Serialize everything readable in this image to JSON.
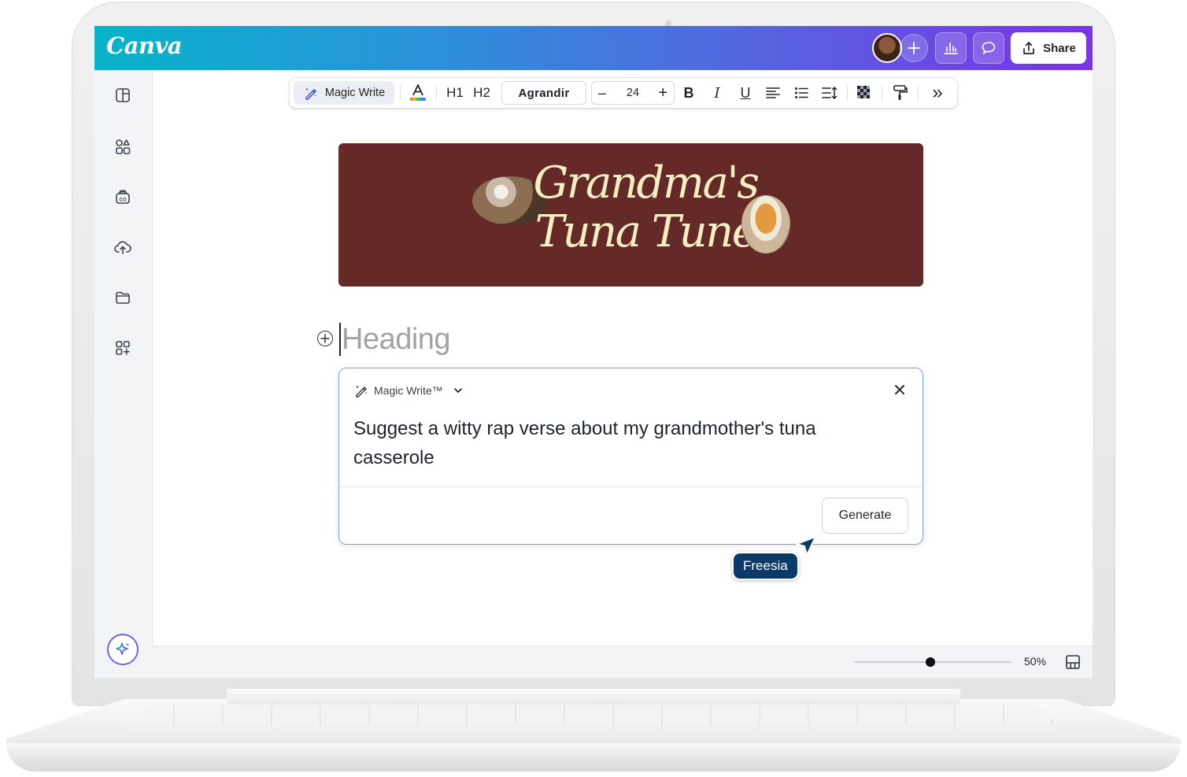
{
  "app": {
    "logo_text": "Canva",
    "brand_gradient": [
      "#07b4c8",
      "#7a33e6"
    ]
  },
  "header": {
    "share_label": "Share",
    "icons": [
      "avatar",
      "add-collaborator-icon",
      "analytics-icon",
      "comment-icon",
      "share-icon"
    ]
  },
  "sidebar": {
    "items": [
      "design-panel-icon",
      "elements-icon",
      "brand-icon",
      "uploads-icon",
      "projects-icon",
      "apps-icon"
    ],
    "magic_icon": "sparkle-icon"
  },
  "toolbar": {
    "magic_write_label": "Magic Write",
    "h1_label": "H1",
    "h2_label": "H2",
    "font_name": "Agrandir",
    "font_size": "24",
    "minus_label": "–",
    "plus_label": "+",
    "bold_label": "B",
    "italic_label": "I",
    "underline_label": "U",
    "more_label": "»"
  },
  "banner": {
    "title_line1": "Grandma's",
    "title_line2": "Tuna Tune",
    "background": "#652927",
    "text_color": "#f6eec4"
  },
  "doc": {
    "heading_placeholder": "Heading"
  },
  "magic_write_panel": {
    "title": "Magic Write™",
    "prompt": "Suggest a witty rap verse about my grandmother's tuna casserole",
    "generate_label": "Generate"
  },
  "collaborator": {
    "name": "Freesia",
    "color": "#0b3a66"
  },
  "footer": {
    "zoom": "50%",
    "zoom_fraction": 0.5
  }
}
